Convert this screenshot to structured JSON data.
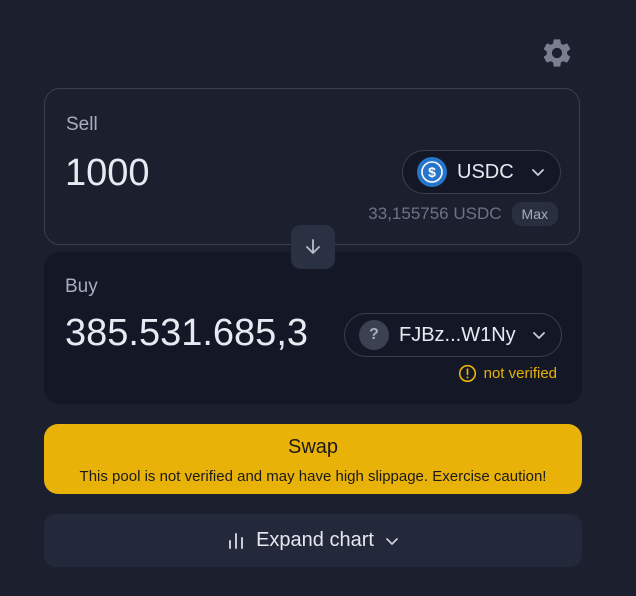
{
  "settings": {
    "icon": "gear-icon",
    "color": "#7a7f8f"
  },
  "sell": {
    "label": "Sell",
    "amount": "1000",
    "token": {
      "symbol": "USDC",
      "icon": "usdc-logo",
      "color": "#2775ca"
    },
    "balance": "33,155756 USDC",
    "max_label": "Max"
  },
  "buy": {
    "label": "Buy",
    "amount": "385.531.685,3",
    "token": {
      "symbol": "FJBz...W1Ny",
      "logo_glyph": "?"
    },
    "warning": "not verified"
  },
  "swap": {
    "label": "Swap",
    "warning": "This pool is not verified and may have high slippage. Exercise caution!",
    "color": "#e9b208"
  },
  "chart_toggle": {
    "label": "Expand chart"
  }
}
